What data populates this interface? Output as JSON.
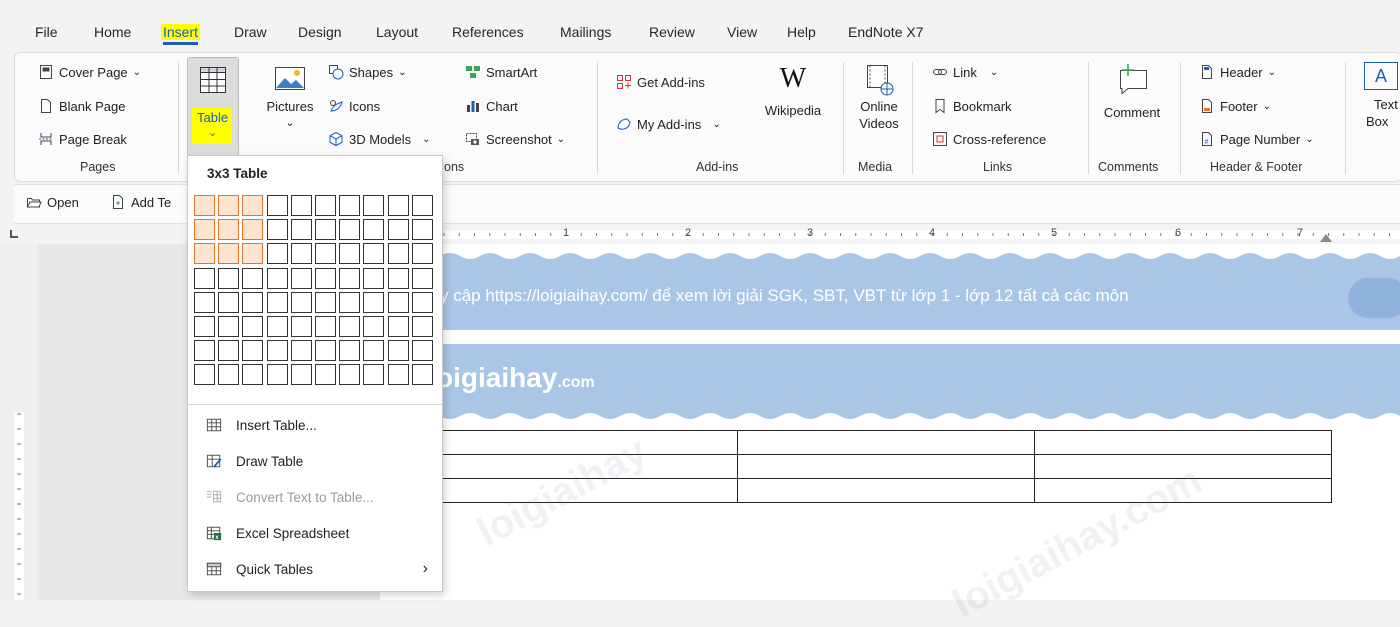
{
  "menu": {
    "tabs": [
      "File",
      "Home",
      "Insert",
      "Draw",
      "Design",
      "Layout",
      "References",
      "Mailings",
      "Review",
      "View",
      "Help",
      "EndNote X7"
    ],
    "active_tab": "Insert"
  },
  "ribbon": {
    "pages": {
      "cover_page": "Cover Page",
      "blank_page": "Blank Page",
      "page_break": "Page Break",
      "label": "Pages"
    },
    "table": {
      "label": "Table"
    },
    "illustrations": {
      "pictures": "Pictures",
      "shapes": "Shapes",
      "icons": "Icons",
      "models_3d": "3D Models",
      "smartart": "SmartArt",
      "chart": "Chart",
      "screenshot": "Screenshot",
      "label_fragment": "ons"
    },
    "addins": {
      "get_addins": "Get Add-ins",
      "my_addins": "My Add-ins",
      "wikipedia": "Wikipedia",
      "wiki_glyph": "W",
      "label": "Add-ins"
    },
    "media": {
      "online_videos_1": "Online",
      "online_videos_2": "Videos",
      "label": "Media"
    },
    "links": {
      "link": "Link",
      "bookmark": "Bookmark",
      "cross_reference": "Cross-reference",
      "label": "Links"
    },
    "comments": {
      "comment": "Comment",
      "label": "Comments"
    },
    "header_footer": {
      "header": "Header",
      "footer": "Footer",
      "page_number": "Page Number",
      "label": "Header & Footer"
    },
    "text": {
      "text_box_1": "Text",
      "text_box_2": "Box"
    }
  },
  "quickbar": {
    "open": "Open",
    "add_text": "Add Te"
  },
  "ruler": {
    "numbers": [
      "1",
      "2",
      "3",
      "4",
      "5",
      "6",
      "7"
    ]
  },
  "document": {
    "banner_text": "y cập https://loigiaihay.com/ để xem lời giải SGK, SBT, VBT từ lớp 1 -  lớp 12 tất cả các môn",
    "logo_main": "oigiaihay",
    "logo_suffix": ".com",
    "watermark_1": "loigiaihay",
    "watermark_2": "loigiaihay.com"
  },
  "table_dropdown": {
    "header": "3x3 Table",
    "selection": {
      "rows": 3,
      "cols": 3
    },
    "grid": {
      "rows": 8,
      "cols": 10
    },
    "items": [
      {
        "label": "Insert Table...",
        "icon": "insert-table-icon",
        "disabled": false
      },
      {
        "label": "Draw Table",
        "icon": "draw-table-icon",
        "disabled": false
      },
      {
        "label": "Convert Text to Table...",
        "icon": "convert-text-icon",
        "disabled": true
      },
      {
        "label": "Excel Spreadsheet",
        "icon": "excel-icon",
        "disabled": false
      },
      {
        "label": "Quick Tables",
        "icon": "quick-tables-icon",
        "disabled": false
      }
    ]
  },
  "colors": {
    "accent": "#1a5fb4",
    "highlight": "#ffff00",
    "grid_selection": "#e8732a",
    "banner": "#a9c6e6"
  }
}
